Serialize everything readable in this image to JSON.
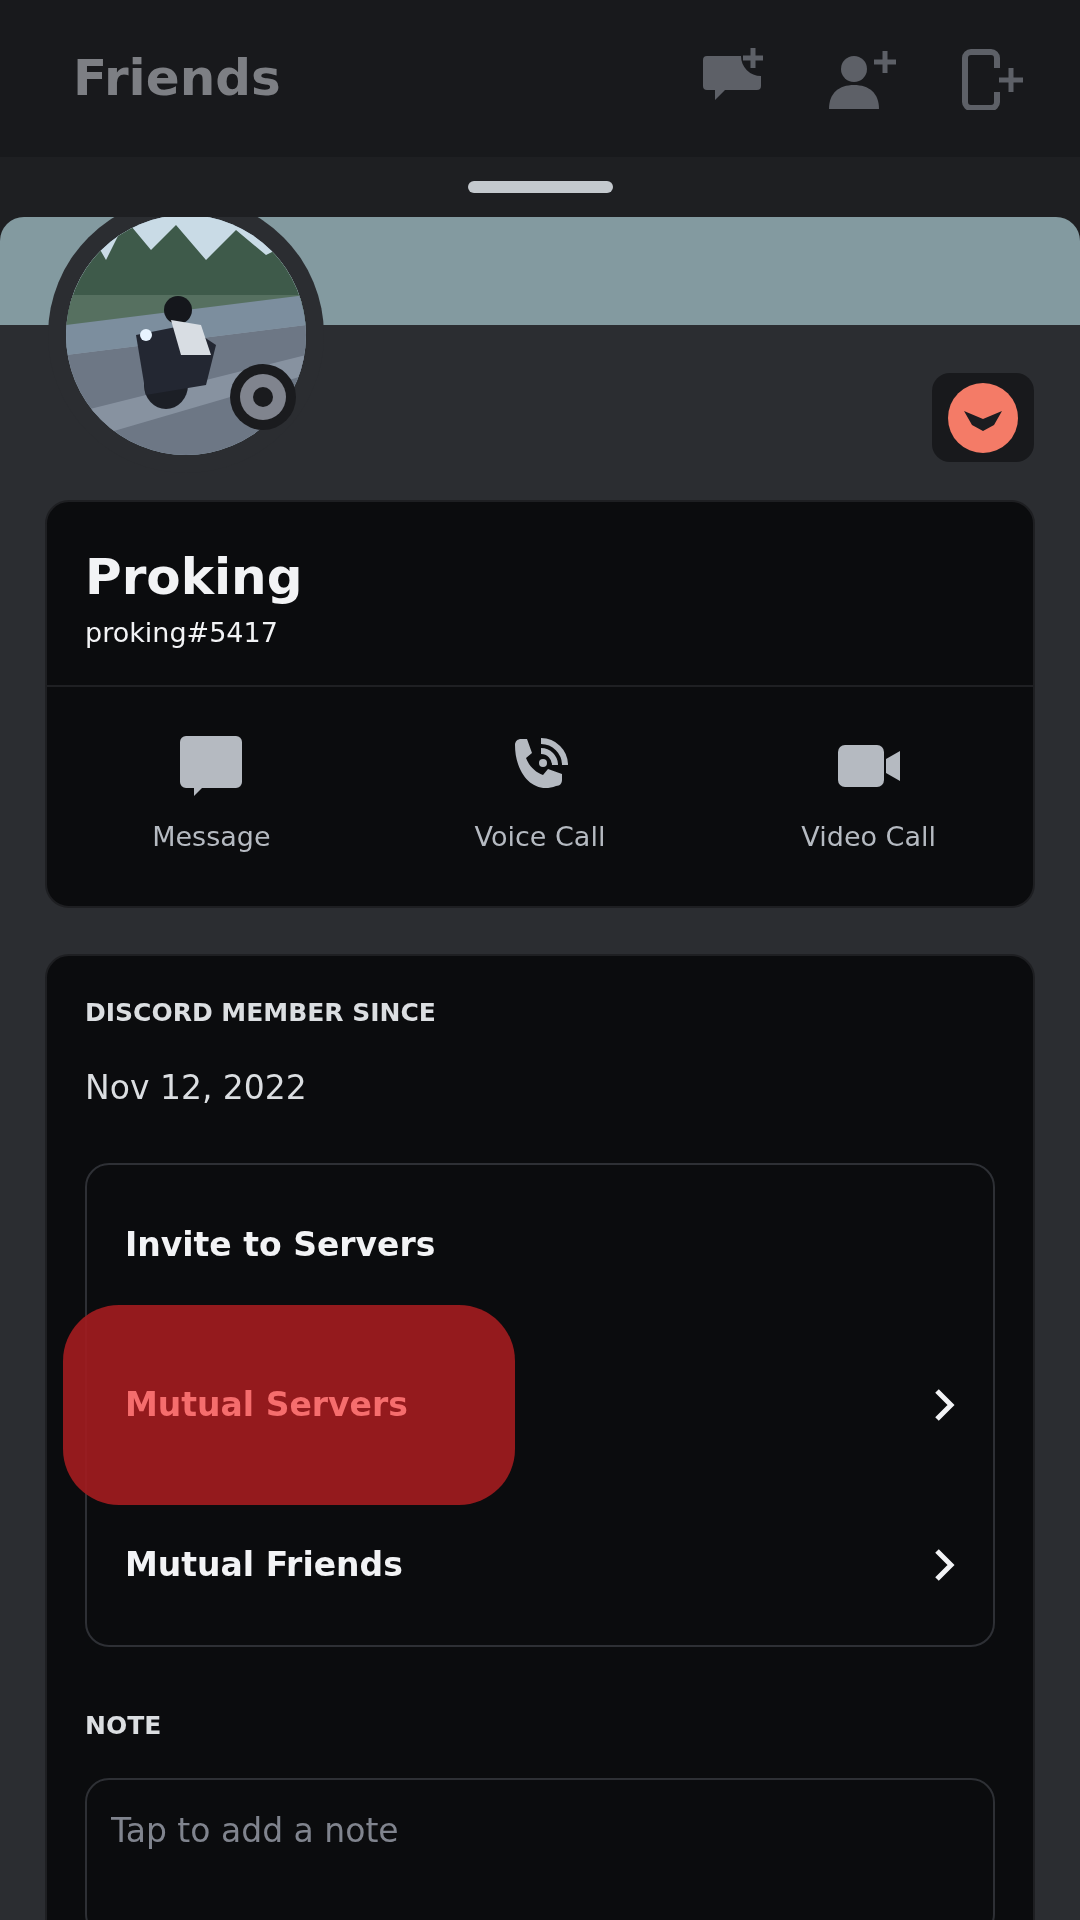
{
  "header": {
    "title": "Friends"
  },
  "profile": {
    "display_name": "Proking",
    "username": "proking#5417"
  },
  "actions": [
    {
      "label": "Message",
      "kind": "message"
    },
    {
      "label": "Voice Call",
      "kind": "voice"
    },
    {
      "label": "Video Call",
      "kind": "video"
    }
  ],
  "member_since": {
    "heading": "DISCORD MEMBER SINCE",
    "date": "Nov 12, 2022"
  },
  "links": [
    {
      "label": "Invite to Servers",
      "chevron": false,
      "selected": false
    },
    {
      "label": "Mutual Servers",
      "chevron": true,
      "selected": true
    },
    {
      "label": "Mutual Friends",
      "chevron": true,
      "selected": false
    }
  ],
  "note": {
    "heading": "NOTE",
    "placeholder": "Tap to add a note"
  }
}
